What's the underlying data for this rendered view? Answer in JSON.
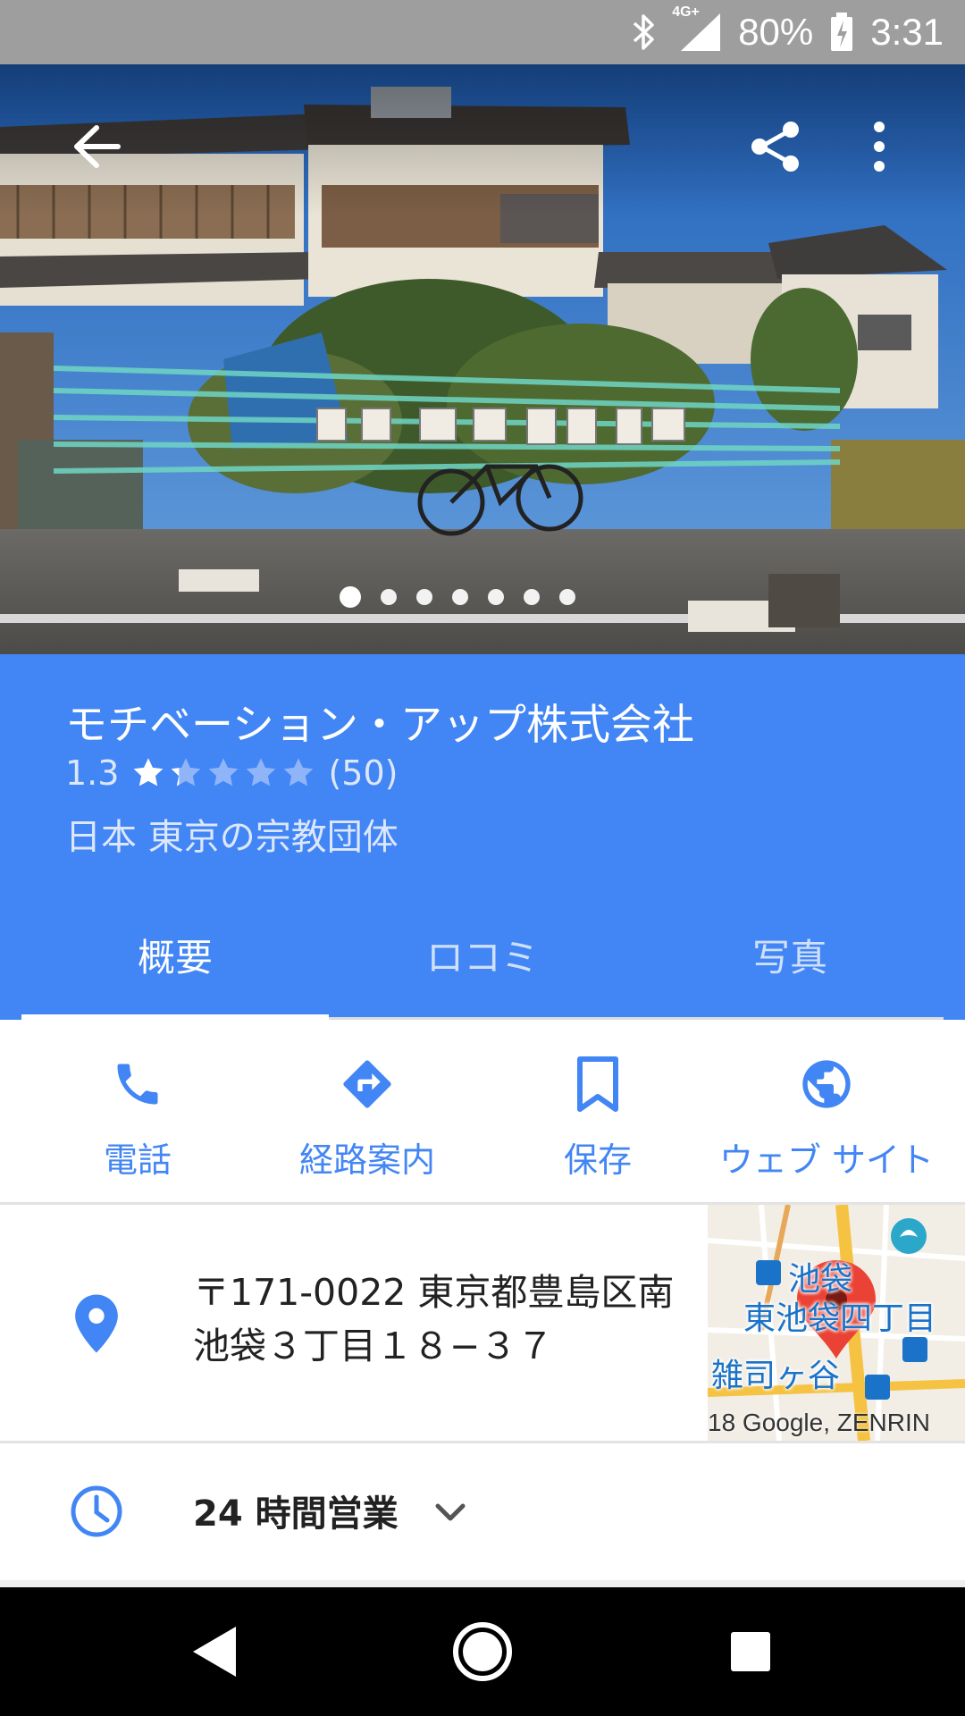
{
  "status_bar": {
    "network": "4G+",
    "battery": "80%",
    "time": "3:31",
    "icons": [
      "bluetooth-icon",
      "signal-icon",
      "battery-charging-icon"
    ]
  },
  "hero": {
    "photo_count": 7,
    "active_photo": 1,
    "icons": [
      "back-arrow-icon",
      "share-icon",
      "more-vert-icon"
    ]
  },
  "place": {
    "name": "モチベーション・アップ株式会社",
    "rating": "1.3",
    "rating_value": 1.3,
    "rating_max": 5,
    "review_count": "(50)",
    "category": "日本 東京の宗教団体"
  },
  "tabs": [
    {
      "label": "概要",
      "active": true
    },
    {
      "label": "ロコミ",
      "active": false
    },
    {
      "label": "写真",
      "active": false
    }
  ],
  "actions": [
    {
      "label": "電話",
      "icon": "phone-icon"
    },
    {
      "label": "経路案内",
      "icon": "directions-icon"
    },
    {
      "label": "保存",
      "icon": "bookmark-icon"
    },
    {
      "label": "ウェブ サイト",
      "icon": "globe-icon"
    }
  ],
  "address": {
    "line1": "〒171-0022 東京都豊島区南",
    "line2": "池袋３丁目１８−３７",
    "map": {
      "label_1": "池袋",
      "label_2": "東池袋四丁目",
      "label_3": "雑司ヶ谷",
      "credit": "18 Google, ZENRIN"
    }
  },
  "hours": {
    "text": "24 時間営業"
  },
  "colors": {
    "accent": "#4285f4",
    "status_bar": "#9e9e9e",
    "map_pin": "#ea4335"
  }
}
